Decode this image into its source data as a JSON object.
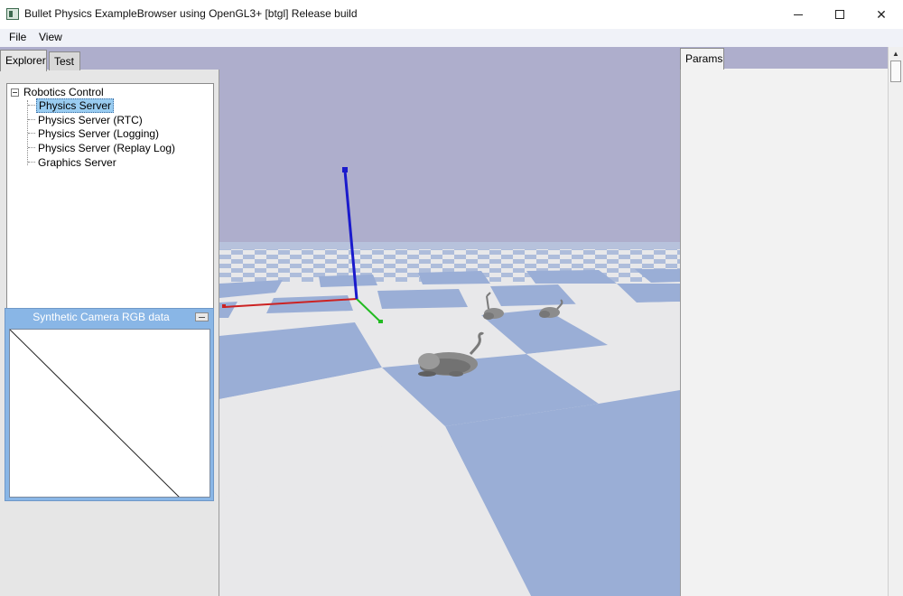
{
  "window": {
    "title": "Bullet Physics ExampleBrowser using OpenGL3+ [btgl] Release build",
    "minimize_glyph": "",
    "maximize_glyph": "",
    "close_glyph": "✕"
  },
  "menu": {
    "items": [
      "File",
      "View"
    ]
  },
  "left_panel": {
    "tabs": [
      "Explorer",
      "Test"
    ],
    "active_tab": "Explorer",
    "tree": {
      "root_label": "Robotics Control",
      "expanded": true,
      "items": [
        {
          "label": "Physics Server",
          "selected": true
        },
        {
          "label": "Physics Server (RTC)",
          "selected": false
        },
        {
          "label": "Physics Server (Logging)",
          "selected": false
        },
        {
          "label": "Physics Server (Replay Log)",
          "selected": false
        },
        {
          "label": "Graphics Server",
          "selected": false
        }
      ]
    }
  },
  "camera_window": {
    "title": "Synthetic Camera RGB data"
  },
  "right_panel": {
    "tab": "Params"
  },
  "colors": {
    "sky": "#aeaecc",
    "floor_light": "#e8e8ea",
    "floor_blue": "#9aaed6",
    "axis_x": "#cc2222",
    "axis_y": "#22bb22",
    "axis_z": "#1a1acc",
    "selection": "#99ccf0",
    "camera_header": "#89b6e6"
  }
}
